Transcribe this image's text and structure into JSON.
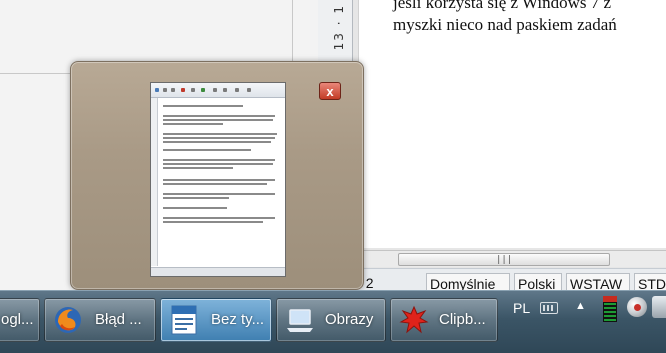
{
  "document": {
    "ruler_text": "13 · 1",
    "page_text": "jeśli korzysta się z Windows 7 z\nmyszki nieco nad paskiem zadań",
    "scroll_grip": "|||"
  },
  "statusbar": {
    "page": "ona  2 / 2",
    "style": "Domyślnie",
    "language": "Polski",
    "mode": "WSTAW",
    "selection": "STD"
  },
  "peek": {
    "close_label": "x"
  },
  "taskbar": {
    "items": [
      {
        "label": "ogl..."
      },
      {
        "label": "Błąd ..."
      },
      {
        "label": "Bez ty..."
      },
      {
        "label": "Obrazy"
      },
      {
        "label": "Clipb..."
      }
    ],
    "active_index": 2
  },
  "tray": {
    "language": "PL",
    "show_hidden": "▲"
  },
  "colors": {
    "taskbar": "#3b5566",
    "active_task": "#3f7fb1",
    "peek_frame": "#a99a86",
    "close_button": "#c23b25"
  },
  "icons": {
    "firefox": "firefox-icon",
    "writer": "writer-document-icon",
    "pictures": "laptop-pictures-icon",
    "clipboard": "clipboard-splat-icon",
    "keyboard": "keyboard-icon",
    "meter": "volume-meter-icon",
    "globe": "network-globe-icon"
  }
}
